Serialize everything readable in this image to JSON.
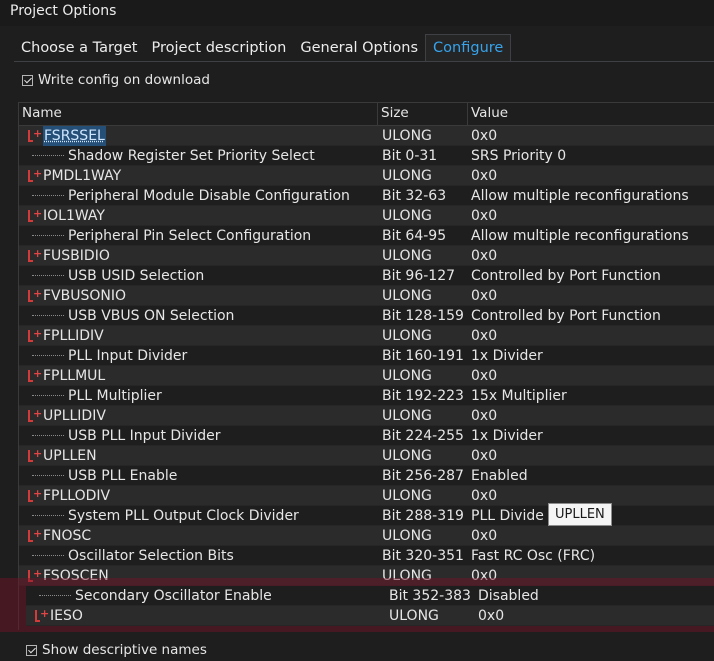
{
  "window": {
    "title": "Project Options"
  },
  "tabs": [
    {
      "label": "Choose a Target"
    },
    {
      "label": "Project description"
    },
    {
      "label": "General Options"
    },
    {
      "label": "Configure",
      "active": true
    }
  ],
  "write_config": {
    "label": "Write config on download",
    "checked": true
  },
  "grid": {
    "headers": {
      "name": "Name",
      "size": "Size",
      "value": "Value"
    },
    "rows": [
      {
        "type": "group",
        "name": "FSRSSEL",
        "size": "ULONG",
        "value": "0x0",
        "selected": true
      },
      {
        "type": "sub",
        "name": "Shadow Register Set Priority Select",
        "size": "Bit 0-31",
        "value": "SRS Priority 0"
      },
      {
        "type": "group",
        "name": "PMDL1WAY",
        "size": "ULONG",
        "value": "0x0"
      },
      {
        "type": "sub",
        "name": "Peripheral Module Disable Configuration",
        "size": "Bit 32-63",
        "value": "Allow multiple reconfigurations"
      },
      {
        "type": "group",
        "name": "IOL1WAY",
        "size": "ULONG",
        "value": "0x0"
      },
      {
        "type": "sub",
        "name": "Peripheral Pin Select Configuration",
        "size": "Bit 64-95",
        "value": "Allow multiple reconfigurations"
      },
      {
        "type": "group",
        "name": "FUSBIDIO",
        "size": "ULONG",
        "value": "0x0"
      },
      {
        "type": "sub",
        "name": "USB USID Selection",
        "size": "Bit 96-127",
        "value": "Controlled by Port Function"
      },
      {
        "type": "group",
        "name": "FVBUSONIO",
        "size": "ULONG",
        "value": "0x0"
      },
      {
        "type": "sub",
        "name": "USB VBUS ON Selection",
        "size": "Bit 128-159",
        "value": "Controlled by Port Function"
      },
      {
        "type": "group",
        "name": "FPLLIDIV",
        "size": "ULONG",
        "value": "0x0"
      },
      {
        "type": "sub",
        "name": "PLL Input Divider",
        "size": "Bit 160-191",
        "value": "1x Divider"
      },
      {
        "type": "group",
        "name": "FPLLMUL",
        "size": "ULONG",
        "value": "0x0"
      },
      {
        "type": "sub",
        "name": "PLL Multiplier",
        "size": "Bit 192-223",
        "value": "15x Multiplier"
      },
      {
        "type": "group",
        "name": "UPLLIDIV",
        "size": "ULONG",
        "value": "0x0"
      },
      {
        "type": "sub",
        "name": "USB PLL Input Divider",
        "size": "Bit 224-255",
        "value": "1x Divider"
      },
      {
        "type": "group",
        "name": "UPLLEN",
        "size": "ULONG",
        "value": "0x0"
      },
      {
        "type": "sub",
        "name": "USB PLL Enable",
        "size": "Bit 256-287",
        "value": "Enabled"
      },
      {
        "type": "group",
        "name": "FPLLODIV",
        "size": "ULONG",
        "value": "0x0"
      },
      {
        "type": "sub",
        "name": "System PLL Output Clock Divider",
        "size": "Bit 288-319",
        "value": "PLL Divide b"
      },
      {
        "type": "group",
        "name": "FNOSC",
        "size": "ULONG",
        "value": "0x0"
      },
      {
        "type": "sub",
        "name": "Oscillator Selection Bits",
        "size": "Bit 320-351",
        "value": "Fast RC Osc (FRC)"
      },
      {
        "type": "group",
        "name": "FSOSCEN",
        "size": "ULONG",
        "value": "0x0"
      }
    ],
    "shifted_rows": [
      {
        "type": "sub",
        "name": "Secondary Oscillator Enable",
        "size": "Bit 352-383",
        "value": "Disabled"
      },
      {
        "type": "group",
        "name": "IESO",
        "size": "ULONG",
        "value": "0x0"
      }
    ]
  },
  "tooltip": {
    "text": "UPLLEN"
  },
  "descriptive_names": {
    "label": "Show descriptive names",
    "checked": true
  }
}
